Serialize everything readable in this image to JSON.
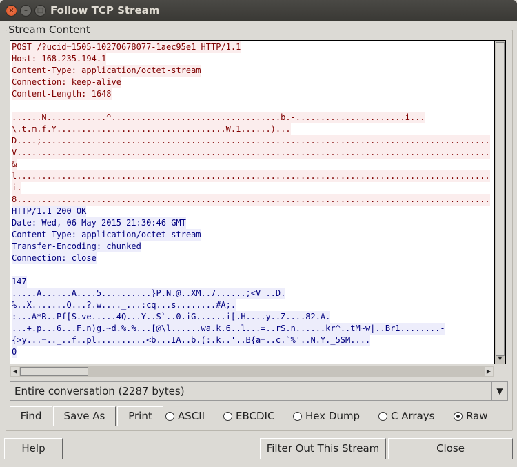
{
  "window": {
    "title": "Follow TCP Stream"
  },
  "group_label": "Stream Content",
  "colors": {
    "client_text": "#7f0000",
    "client_bg": "#fbeded",
    "server_text": "#00007f",
    "server_bg": "#ededfb"
  },
  "stream": [
    {
      "dir": "c",
      "text": "POST /?ucid=1505-10270678077-1aec95e1 HTTP/1.1"
    },
    {
      "dir": "c",
      "text": "Host: 168.235.194.1"
    },
    {
      "dir": "c",
      "text": "Content-Type: application/octet-stream"
    },
    {
      "dir": "c",
      "text": "Connection: keep-alive"
    },
    {
      "dir": "c",
      "text": "Content-Length: 1648"
    },
    {
      "dir": "c",
      "text": ""
    },
    {
      "dir": "c",
      "text": "......N............^..................................b.-......................i..."
    },
    {
      "dir": "c",
      "text": "\\.t.m.f.Y..................................W.1......)..."
    },
    {
      "dir": "c",
      "text": "D....;.........................................................................................."
    },
    {
      "dir": "c",
      "text": "V..............................................................................................."
    },
    {
      "dir": "c",
      "text": "&"
    },
    {
      "dir": "c",
      "text": "l..............................................................................................."
    },
    {
      "dir": "c",
      "text": "i."
    },
    {
      "dir": "c",
      "text": "8..............................................................................................."
    },
    {
      "dir": "s",
      "text": "HTTP/1.1 200 OK"
    },
    {
      "dir": "s",
      "text": "Date: Wed, 06 May 2015 21:30:46 GMT"
    },
    {
      "dir": "s",
      "text": "Content-Type: application/octet-stream"
    },
    {
      "dir": "s",
      "text": "Transfer-Encoding: chunked"
    },
    {
      "dir": "s",
      "text": "Connection: close"
    },
    {
      "dir": "s",
      "text": ""
    },
    {
      "dir": "s",
      "text": "147"
    },
    {
      "dir": "s",
      "text": ".....A......A....5..........}P.N.@..XM..7......;<V ..D."
    },
    {
      "dir": "s",
      "text": "%..X.......Q...?.w...._...:cq...s........#A;."
    },
    {
      "dir": "s",
      "text": ":...A*R..Pf[S.ve.....4Q...Y..S`..0.iG......i[.H....y..Z....82.A."
    },
    {
      "dir": "s",
      "text": "...+.p...6...F.n)g.~d.%.%...[@\\l......wa.k.6..l...=..rS.n......kr^..tM~w|..Br1........-"
    },
    {
      "dir": "s",
      "text": "{>y...=.._..f..pl..........<b...IA..b.(:.k..'..B{a=..c.`%'..N.Y._5SM...."
    },
    {
      "dir": "s",
      "text": "0"
    }
  ],
  "conversation_select": "Entire conversation (2287 bytes)",
  "buttons": {
    "find": "Find",
    "save_as": "Save As",
    "print": "Print",
    "help": "Help",
    "filter_out": "Filter Out This Stream",
    "close": "Close"
  },
  "formats": [
    {
      "label": "ASCII",
      "selected": false
    },
    {
      "label": "EBCDIC",
      "selected": false
    },
    {
      "label": "Hex Dump",
      "selected": false
    },
    {
      "label": "C Arrays",
      "selected": false
    },
    {
      "label": "Raw",
      "selected": true
    }
  ]
}
